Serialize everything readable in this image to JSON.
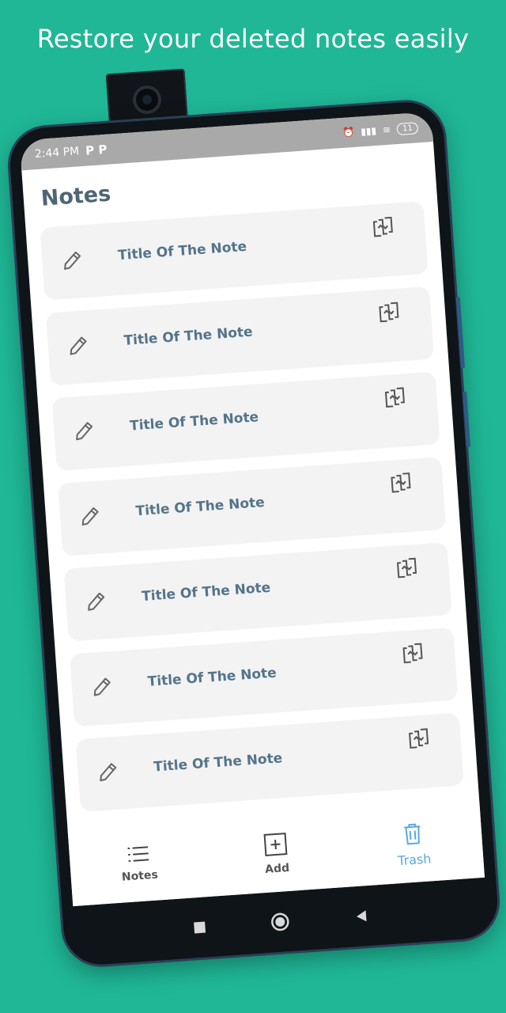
{
  "headline": "Restore your deleted notes easily",
  "status_bar": {
    "time": "2:44 PM",
    "app_icons": "P P",
    "battery": "11"
  },
  "app": {
    "title": "Notes",
    "notes": [
      {
        "title": "Title Of The Note"
      },
      {
        "title": "Title Of The Note"
      },
      {
        "title": "Title Of The Note"
      },
      {
        "title": "Title Of The Note"
      },
      {
        "title": "Title Of The Note"
      },
      {
        "title": "Title Of The Note"
      },
      {
        "title": "Title Of The Note"
      }
    ]
  },
  "bottom_nav": {
    "notes_label": "Notes",
    "add_label": "Add",
    "trash_label": "Trash",
    "active": "trash"
  },
  "colors": {
    "background": "#1fb796",
    "title_text": "#54748a",
    "accent": "#5aa9dc"
  }
}
